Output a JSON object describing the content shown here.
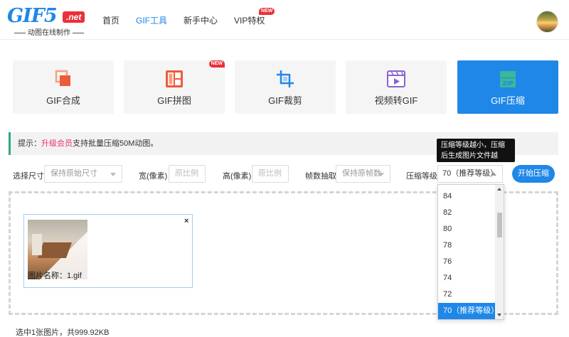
{
  "header": {
    "logo_text": "GIF5",
    "logo_net": ".net",
    "logo_sub": "动图在线制作",
    "nav": [
      {
        "label": "首页"
      },
      {
        "label": "GIF工具"
      },
      {
        "label": "新手中心"
      },
      {
        "label": "VIP特权",
        "badge": "NEW"
      }
    ]
  },
  "tools": [
    {
      "label": "GIF合成",
      "icon": "merge-icon"
    },
    {
      "label": "GIF拼图",
      "icon": "collage-icon",
      "badge": "NEW"
    },
    {
      "label": "GIF裁剪",
      "icon": "crop-icon"
    },
    {
      "label": "视频转GIF",
      "icon": "video-icon"
    },
    {
      "label": "GIF压缩",
      "icon": "zip-icon"
    }
  ],
  "tip": {
    "prefix": "提示：",
    "link": "升级会员",
    "suffix": "支持批量压缩50M动图。"
  },
  "tooltip": "压缩等级越小，压缩后生成图片文件越小。",
  "options": {
    "size_label": "选择尺寸",
    "size_value": "保持原始尺寸",
    "width_label": "宽(像素)",
    "width_placeholder": "原比例",
    "height_label": "高(像素)",
    "height_placeholder": "原比例",
    "frame_label": "帧数抽取",
    "frame_value": "保持原帧数",
    "level_label": "压缩等级",
    "level_value": "70（推荐等级）",
    "start_label": "开始压缩"
  },
  "dropdown": {
    "items": [
      "84",
      "82",
      "80",
      "78",
      "76",
      "74",
      "72",
      "70（推荐等级）"
    ],
    "selected_index": 7
  },
  "upload": {
    "file_name": "图片名称：1.gif",
    "close": "×"
  },
  "status": "选中1张图片，共999.92KB",
  "colors": {
    "accent": "#1f87e8",
    "badge": "#ec2f3b",
    "tip_border": "#2fa58a",
    "vip_link": "#ec2f6b"
  }
}
